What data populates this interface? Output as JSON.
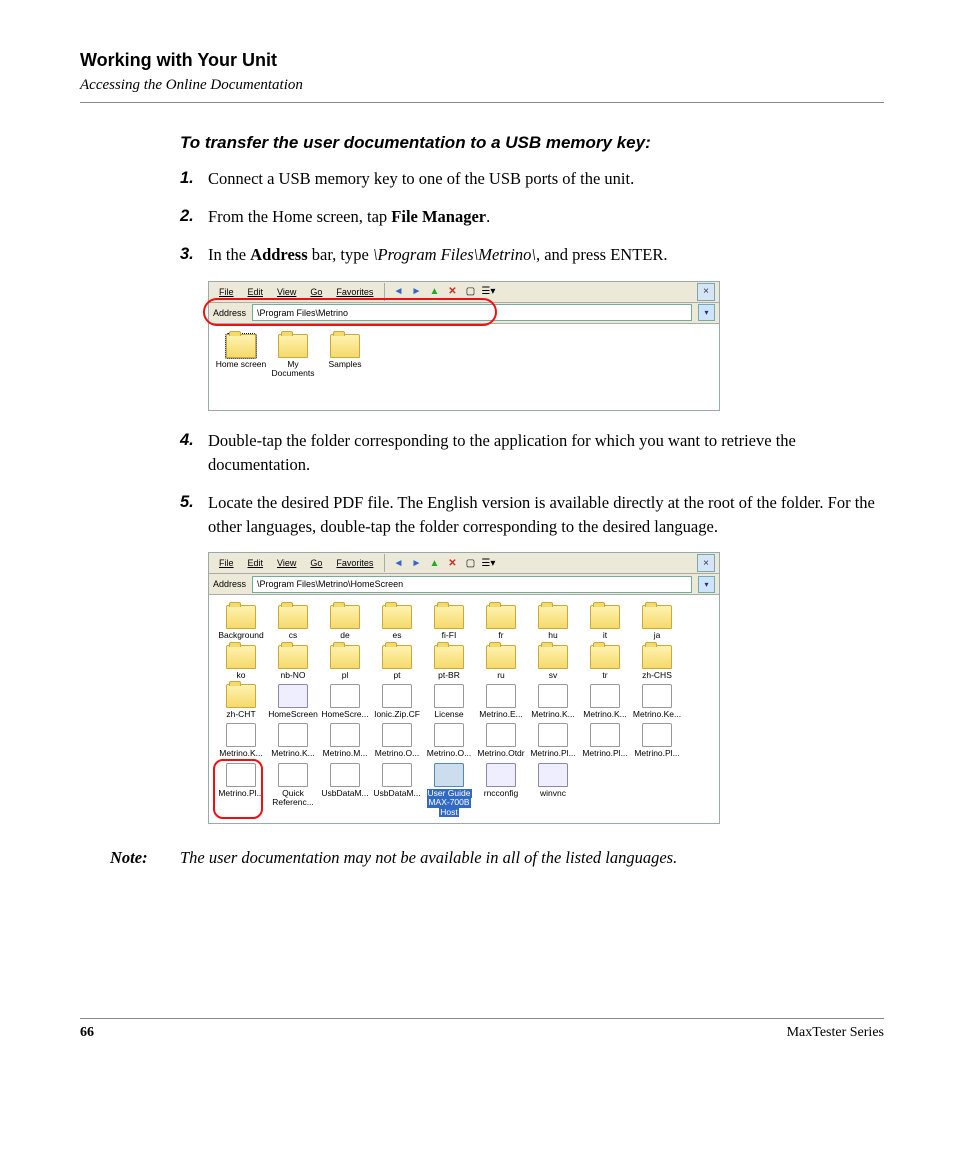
{
  "header": {
    "chapter": "Working with Your Unit",
    "section": "Accessing the Online Documentation"
  },
  "lead": "To transfer the user documentation to a USB memory key:",
  "steps": {
    "s1": {
      "num": "1.",
      "text": "Connect a USB memory key to one of the USB ports of the unit."
    },
    "s2": {
      "num": "2.",
      "pre": "From the Home screen, tap ",
      "bold": "File Manager",
      "post": "."
    },
    "s3": {
      "num": "3.",
      "pre": "In the ",
      "bold": "Address",
      "mid": " bar, type ",
      "ital": "\\Program Files\\Metrino\\",
      "post": ", and press ENTER."
    },
    "s4": {
      "num": "4.",
      "text": "Double-tap the folder corresponding to the application for which you want to retrieve the documentation."
    },
    "s5": {
      "num": "5.",
      "text": "Locate the desired PDF file. The English version is available directly at the root of the folder. For the other languages, double-tap the folder corresponding to the desired language."
    }
  },
  "fm": {
    "menu": {
      "file": "File",
      "edit": "Edit",
      "view": "View",
      "go": "Go",
      "fav": "Favorites"
    },
    "addressLabel": "Address",
    "close": "×"
  },
  "shot1": {
    "address": "\\Program Files\\Metrino",
    "items": [
      "Home screen",
      "My Documents",
      "Samples"
    ]
  },
  "shot2": {
    "address": "\\Program Files\\Metrino\\HomeScreen",
    "folders": [
      "Background",
      "cs",
      "de",
      "es",
      "fi-FI",
      "fr",
      "hu",
      "it",
      "ja",
      "ko",
      "nb-NO",
      "pl",
      "pt",
      "pt-BR",
      "ru",
      "sv",
      "tr",
      "zh-CHS",
      "zh-CHT"
    ],
    "specialHome": "HomeScreen",
    "files": [
      "HomeScre...",
      "Ionic.Zip.CF",
      "License",
      "Metrino.E...",
      "Metrino.K...",
      "Metrino.K...",
      "Metrino.Ke...",
      "Metrino.K...",
      "Metrino.K...",
      "Metrino.M...",
      "Metrino.O...",
      "Metrino.O...",
      "Metrino.Otdr",
      "Metrino.Pl...",
      "Metrino.Pl...",
      "Metrino.Pl...",
      "Metrino.Pl...",
      "Quick Referenc...",
      "UsbDataM...",
      "UsbDataM..."
    ],
    "selectedLines": [
      "User Guide",
      "MAX-700B",
      "Host"
    ],
    "extras": [
      "rncconfig",
      "winvnc"
    ]
  },
  "note": {
    "label": "Note:",
    "text": "The user documentation may not be available in all of the listed languages."
  },
  "footer": {
    "page": "66",
    "series": "MaxTester Series"
  }
}
